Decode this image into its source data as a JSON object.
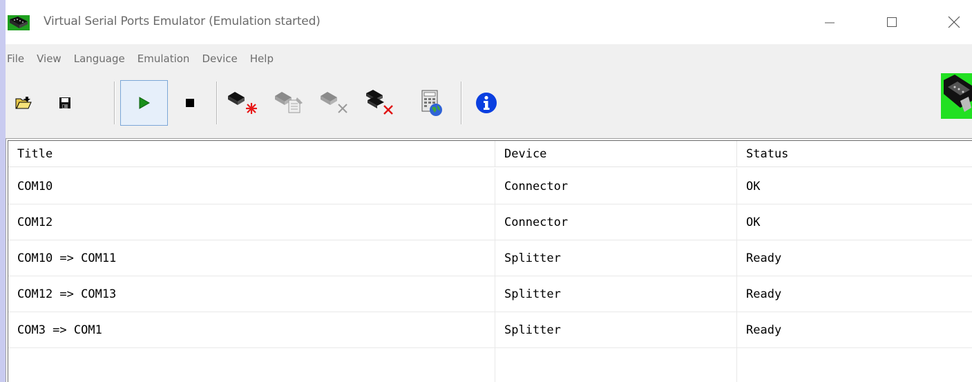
{
  "window": {
    "title": "Virtual Serial Ports Emulator (Emulation started)",
    "app_icon": "vspe-app-icon",
    "controls": [
      "minimize-icon",
      "maximize-icon",
      "close-icon"
    ]
  },
  "menu": {
    "items": [
      "File",
      "View",
      "Language",
      "Emulation",
      "Device",
      "Help"
    ]
  },
  "toolbar": {
    "tools": [
      {
        "name": "open-icon",
        "tip": "Open"
      },
      {
        "name": "save-icon",
        "tip": "Save"
      },
      {
        "name": "start-emulation-icon",
        "tip": "Start emulation",
        "pressed": true
      },
      {
        "name": "stop-emulation-icon",
        "tip": "Stop emulation"
      },
      {
        "name": "create-device-icon",
        "tip": "Create device"
      },
      {
        "name": "edit-device-icon",
        "tip": "Edit device",
        "disabled": true
      },
      {
        "name": "delete-device-icon",
        "tip": "Delete device",
        "disabled": true
      },
      {
        "name": "delete-all-devices-icon",
        "tip": "Delete all devices"
      },
      {
        "name": "web-calculator-icon",
        "tip": "Web"
      },
      {
        "name": "info-icon",
        "tip": "About"
      }
    ],
    "logo": "vspe-logo-icon"
  },
  "table": {
    "columns": [
      "Title",
      "Device",
      "Status"
    ],
    "rows": [
      {
        "title": "COM10",
        "device": "Connector",
        "status": "OK"
      },
      {
        "title": "COM12",
        "device": "Connector",
        "status": "OK"
      },
      {
        "title": "COM10 => COM11",
        "device": "Splitter",
        "status": "Ready"
      },
      {
        "title": "COM12 => COM13",
        "device": "Splitter",
        "status": "Ready"
      },
      {
        "title": "COM3 => COM1",
        "device": "Splitter",
        "status": "Ready"
      }
    ]
  },
  "colors": {
    "background": "#c9cbf0",
    "titlebar": "#ffffff",
    "chrome": "#f0f0f0",
    "play_green": "#1a8f1a",
    "info_blue": "#0a3fe0",
    "delete_red": "#e01010",
    "logo_green": "#22e022"
  }
}
